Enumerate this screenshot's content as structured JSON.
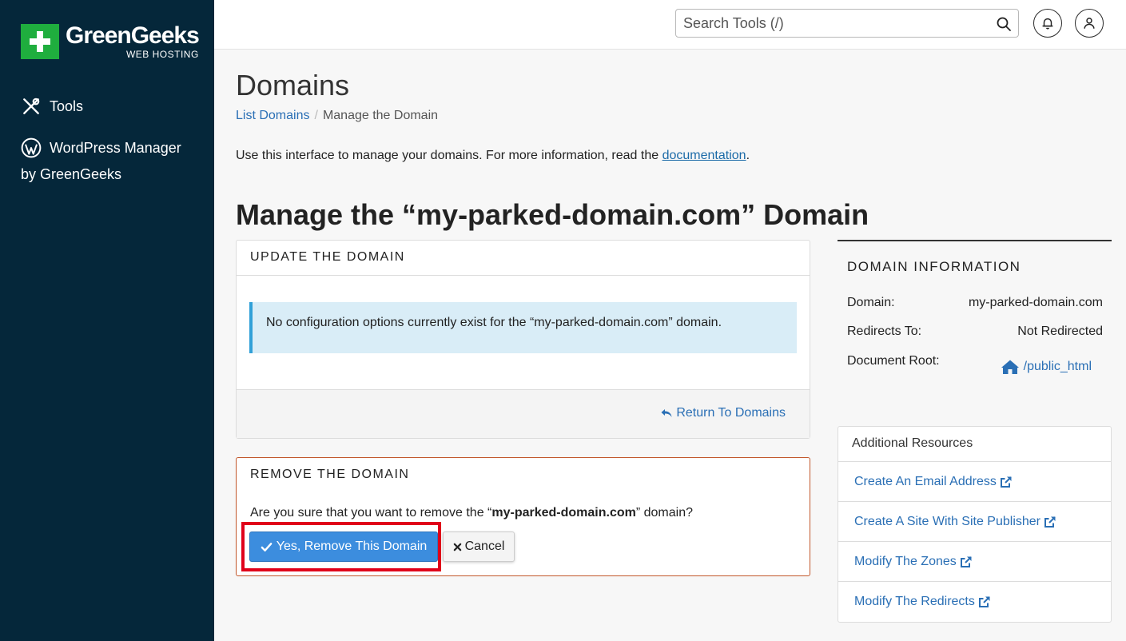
{
  "sidebar": {
    "logo": {
      "name": "GreenGeeks",
      "sub": "WEB HOSTING"
    },
    "items": [
      {
        "label": "Tools",
        "icon": "tools-icon"
      },
      {
        "label": "WordPress Manager",
        "sub": "by GreenGeeks",
        "icon": "wordpress-icon"
      }
    ]
  },
  "header": {
    "search_placeholder": "Search Tools (/)"
  },
  "page": {
    "title": "Domains",
    "breadcrumb": {
      "link": "List Domains",
      "current": "Manage the Domain"
    },
    "intro_text": "Use this interface to manage your domains. For more information, read the ",
    "intro_link": "documentation",
    "intro_end": ".",
    "manage_title": "Manage the “my-parked-domain.com” Domain"
  },
  "update": {
    "heading": "UPDATE THE DOMAIN",
    "alert": "No configuration options currently exist for the “my-parked-domain.com” domain.",
    "return_label": "Return To Domains"
  },
  "remove": {
    "heading": "REMOVE THE DOMAIN",
    "question_pre": "Are you sure that you want to remove the “",
    "question_domain": "my-parked-domain.com",
    "question_post": "” domain?",
    "yes_label": "Yes, Remove This Domain",
    "cancel_label": "Cancel"
  },
  "info": {
    "heading": "DOMAIN INFORMATION",
    "domain_label": "Domain:",
    "domain_value": "my-parked-domain.com",
    "redirects_label": "Redirects To:",
    "redirects_value": "Not Redirected",
    "docroot_label": "Document Root:",
    "docroot_value": "/public_html"
  },
  "resources": {
    "heading": "Additional Resources",
    "items": [
      "Create An Email Address",
      "Create A Site With Site Publisher",
      "Modify The Zones",
      "Modify The Redirects"
    ]
  },
  "colors": {
    "sidebar_bg": "#05273a",
    "brand_green": "#1fae3e",
    "primary_button": "#3c8dde",
    "link": "#2a6fb5",
    "highlight": "#e0001a"
  }
}
